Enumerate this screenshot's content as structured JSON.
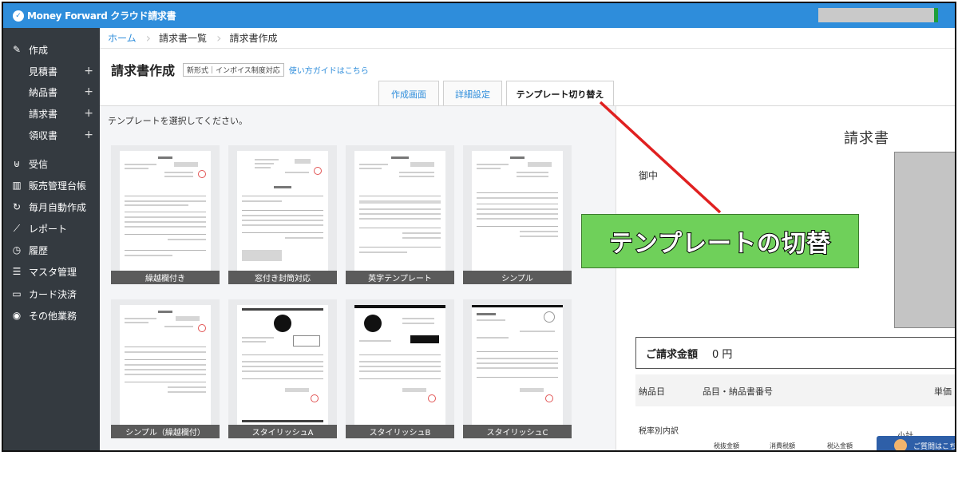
{
  "app": {
    "brand": "Money Forward クラウド請求書",
    "logo_glyph": "✓"
  },
  "sidebar": {
    "items": [
      {
        "label": "作成",
        "icon": "pencil-icon"
      },
      {
        "label": "見積書",
        "plus": "+"
      },
      {
        "label": "納品書",
        "plus": "+"
      },
      {
        "label": "請求書",
        "plus": "+"
      },
      {
        "label": "領収書",
        "plus": "+"
      },
      {
        "label": "受信",
        "icon": "inbox-icon"
      },
      {
        "label": "販売管理台帳",
        "icon": "book-icon"
      },
      {
        "label": "毎月自動作成",
        "icon": "repeat-icon"
      },
      {
        "label": "レポート",
        "icon": "chart-icon"
      },
      {
        "label": "履歴",
        "icon": "history-icon"
      },
      {
        "label": "マスタ管理",
        "icon": "list-icon"
      },
      {
        "label": "カード決済",
        "icon": "card-icon"
      },
      {
        "label": "その他業務",
        "icon": "other-icon"
      }
    ]
  },
  "breadcrumb": [
    "ホーム",
    "請求書一覧",
    "請求書作成"
  ],
  "page": {
    "title": "請求書作成",
    "format_badge": "新形式｜インボイス制度対応",
    "guide_link": "使い方ガイドはこちら"
  },
  "tabs": [
    "作成画面",
    "詳細設定",
    "テンプレート切り替え"
  ],
  "templates": {
    "instruction": "テンプレートを選択してください。",
    "cards": [
      {
        "name": "繰越欄付き"
      },
      {
        "name": "窓付き封筒対応"
      },
      {
        "name": "英字テンプレート"
      },
      {
        "name": "シンプル"
      },
      {
        "name": "シンプル（繰越欄付）"
      },
      {
        "name": "スタイリッシュA"
      },
      {
        "name": "スタイリッシュB"
      },
      {
        "name": "スタイリッシュC"
      }
    ]
  },
  "preview": {
    "title": "請求書",
    "recipient_suffix": "御中",
    "amount_label": "ご請求金額",
    "amount_value": "0 円",
    "columns": [
      "納品日",
      "品目・納品書番号",
      "単価"
    ],
    "tax_breakdown_label": "税率別内訳",
    "subtotal_label": "小計",
    "tax_columns": [
      "税抜金額",
      "消費税額",
      "税込金額"
    ]
  },
  "help": {
    "label": "ご質問はこち"
  },
  "annotation": {
    "callout_text": "テンプレートの切替",
    "arrow_color": "#e02020",
    "callout_color": "#6fd05a"
  },
  "colors": {
    "topbar": "#2e8ddb",
    "sidebar": "#343a40",
    "link": "#2e8ddb"
  }
}
